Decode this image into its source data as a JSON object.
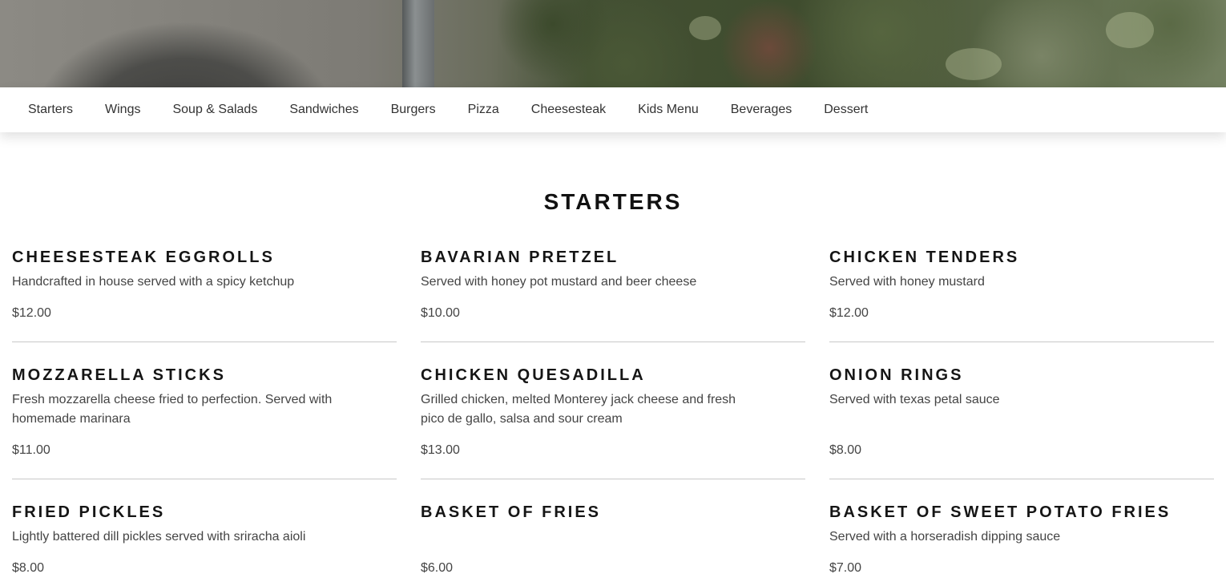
{
  "nav": {
    "items": [
      "Starters",
      "Wings",
      "Soup & Salads",
      "Sandwiches",
      "Burgers",
      "Pizza",
      "Cheesesteak",
      "Kids Menu",
      "Beverages",
      "Dessert"
    ]
  },
  "section": {
    "title": "STARTERS"
  },
  "menu_items": [
    {
      "name": "CHEESESTEAK EGGROLLS",
      "description": "Handcrafted in house served with a spicy ketchup",
      "price": "$12.00"
    },
    {
      "name": "BAVARIAN PRETZEL",
      "description": "Served with honey pot mustard and beer cheese",
      "price": "$10.00"
    },
    {
      "name": "CHICKEN TENDERS",
      "description": "Served with honey mustard",
      "price": "$12.00"
    },
    {
      "name": "MOZZARELLA STICKS",
      "description": "Fresh mozzarella cheese fried to perfection. Served with homemade marinara",
      "price": "$11.00"
    },
    {
      "name": "CHICKEN QUESADILLA",
      "description": "Grilled chicken, melted Monterey jack cheese and fresh pico de gallo, salsa and sour cream",
      "price": "$13.00"
    },
    {
      "name": "ONION RINGS",
      "description": "Served with texas petal sauce",
      "price": "$8.00"
    },
    {
      "name": "FRIED PICKLES",
      "description": "Lightly battered dill pickles served with sriracha aioli",
      "price": "$8.00"
    },
    {
      "name": "BASKET OF FRIES",
      "description": "",
      "price": "$6.00"
    },
    {
      "name": "BASKET OF SWEET POTATO FRIES",
      "description": "Served with a horseradish dipping sauce",
      "price": "$7.00"
    }
  ]
}
